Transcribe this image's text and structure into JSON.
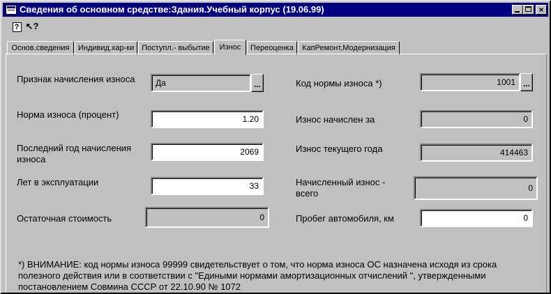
{
  "window": {
    "title": "Сведения об основном средстве:Здания.Учебный корпус (19.06.99)",
    "min_label": "_",
    "close_label": "×"
  },
  "toolbar": {
    "help_label": "?",
    "whatsthis_label": "↖?"
  },
  "tabs": [
    {
      "label": "Основ.сведения",
      "active": false
    },
    {
      "label": "Индивид.хар-ки",
      "active": false
    },
    {
      "label": "Поступл.- выбытие",
      "active": false
    },
    {
      "label": "Износ",
      "active": true
    },
    {
      "label": "Переоценка",
      "active": false
    },
    {
      "label": "КапРемонт,Модернизация",
      "active": false
    }
  ],
  "form": {
    "depreciation_flag": {
      "label": "Признак начисления износа",
      "value": "Да",
      "button": "..."
    },
    "depreciation_rate": {
      "label": "Норма износа (процент)",
      "value": "1.20"
    },
    "last_year": {
      "label": "Последний год начисления износа",
      "value": "2069"
    },
    "years_in_use": {
      "label": "Лет в эксплуатации",
      "value": "33"
    },
    "residual_value": {
      "label": "Остаточная стоимость",
      "value": "0"
    },
    "rate_code": {
      "label": "Код нормы износа *)",
      "value": "1001",
      "button": "..."
    },
    "charged_for": {
      "label": "Износ начислен за",
      "value": "0"
    },
    "current_year": {
      "label": "Износ текущего года",
      "value": "414463"
    },
    "total_charged": {
      "label": "Начисленный износ - всего",
      "value": "0"
    },
    "mileage": {
      "label": "Пробег автомобиля, км",
      "value": "0"
    }
  },
  "note": "*) ВНИМАНИЕ: код нормы износа 99999 свидетельствует о том, что  норма износа ОС назначена исходя из срока полезного действия  или в соответствии с \"Едиными нормами амортизационных отчислений \", утвержденными постановлением Совмина СССР от 22.10.90 № 1072"
}
